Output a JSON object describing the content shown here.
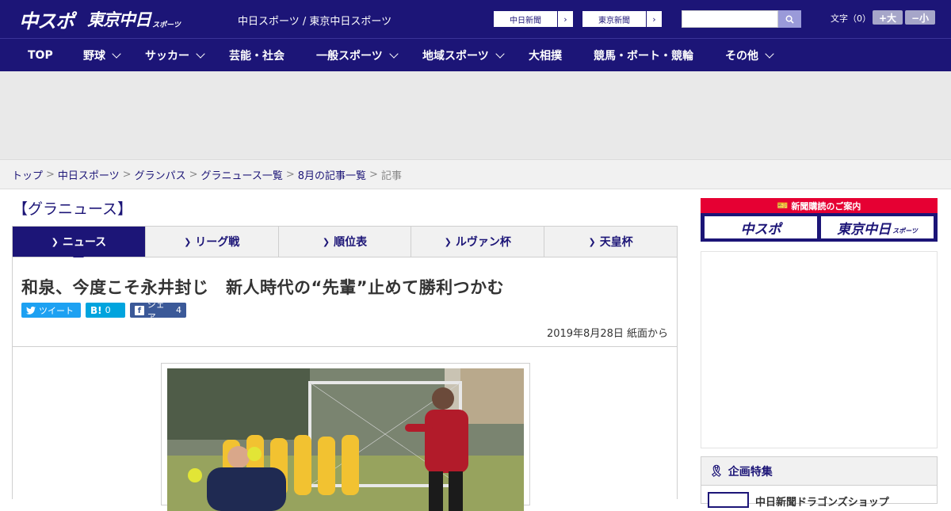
{
  "header": {
    "logo_main": "中スポ",
    "logo_tokyo": "東京中日",
    "logo_tokyo_sub": "スポーツ",
    "site_caption": "中日スポーツ / 東京中日スポーツ",
    "paper_links": [
      {
        "label": "中日新聞"
      },
      {
        "label": "東京新聞"
      }
    ],
    "search": {
      "placeholder": "",
      "value": ""
    },
    "text_size_label": "文字（0）",
    "size_up_label": "+大",
    "size_down_label": "−小"
  },
  "nav": {
    "items": [
      {
        "label": "TOP",
        "has_dropdown": false
      },
      {
        "label": "野球",
        "has_dropdown": true
      },
      {
        "label": "サッカー",
        "has_dropdown": true
      },
      {
        "label": "芸能・社会",
        "has_dropdown": false
      },
      {
        "label": "一般スポーツ",
        "has_dropdown": true
      },
      {
        "label": "地域スポーツ",
        "has_dropdown": true
      },
      {
        "label": "大相撲",
        "has_dropdown": false
      },
      {
        "label": "競馬・ボート・競輪",
        "has_dropdown": false
      },
      {
        "label": "その他",
        "has_dropdown": true
      }
    ]
  },
  "breadcrumb": {
    "items": [
      "トップ",
      "中日スポーツ",
      "グランパス",
      "グラニュース一覧",
      "8月の記事一覧"
    ],
    "current": "記事",
    "separator": ">"
  },
  "section": {
    "title": "【グラニュース】"
  },
  "tabs": [
    {
      "label": "ニュース",
      "active": true
    },
    {
      "label": "リーグ戦",
      "active": false
    },
    {
      "label": "順位表",
      "active": false
    },
    {
      "label": "ルヴァン杯",
      "active": false
    },
    {
      "label": "天皇杯",
      "active": false
    }
  ],
  "article": {
    "headline": "和泉、今度こそ永井封じ　新人時代の“先輩”止めて勝利つかむ",
    "share": {
      "tweet_label": "ツイート",
      "hatena_icon": "B!",
      "hatena_count": "0",
      "fb_label": "シェア",
      "fb_count": "4"
    },
    "date": "2019年8月28日 紙面から"
  },
  "sidebar": {
    "subscribe_banner": {
      "title": "新聞購読のご案内",
      "left_logo": "中スポ",
      "right_logo": "東京中日",
      "right_logo_sub": "スポーツ"
    },
    "feature": {
      "heading": "企画特集",
      "item_text": "中日新聞ドラゴンズショップ"
    }
  },
  "colors": {
    "brand_navy": "#1c1577",
    "red": "#e60033",
    "twitter": "#1da1f2",
    "hatena": "#00a4de",
    "facebook": "#3b5998"
  }
}
